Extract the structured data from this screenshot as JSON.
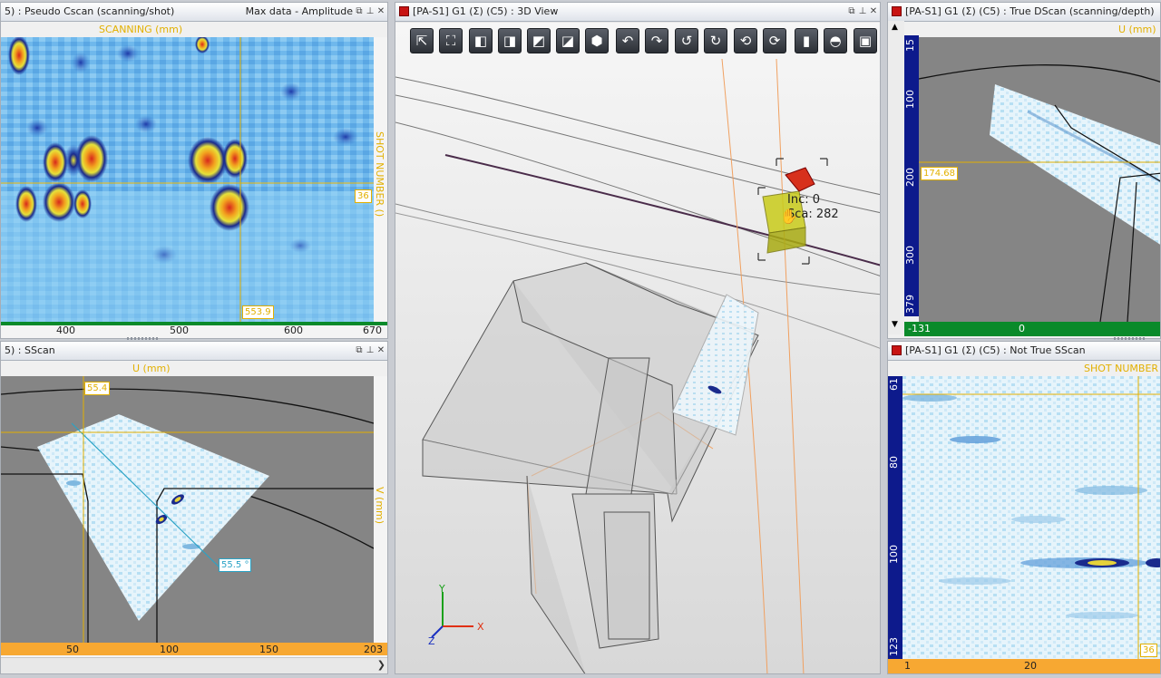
{
  "colors": {
    "accent": "#e2b000",
    "cursor_blue": "#2aa3c6",
    "green_bar": "#0a8a2a",
    "orange_bar": "#f7a832",
    "navy_bar": "#0d1a8c"
  },
  "cscan": {
    "title": "5) : Pseudo Cscan (scanning/shot)",
    "title_right": "Max data - Amplitude",
    "x_axis_label": "SCANNING (mm)",
    "y_axis_label": "SHOT NUMBER ()",
    "cursor_y": "36",
    "cursor_x": "553.9",
    "ticks": [
      "400",
      "500",
      "600",
      "670"
    ]
  },
  "sscan": {
    "title": "5) : SScan",
    "x_axis_label": "U (mm)",
    "y_axis_label": "V (mm)",
    "cursor_u": "55.4",
    "cursor_angle": "55.5 °",
    "ticks": [
      "50",
      "100",
      "150",
      "203"
    ]
  },
  "view3d": {
    "title": "[PA-S1] G1 (Σ) (C5) : 3D View",
    "toolbar": [
      "select-tool",
      "fit-view",
      "view-front",
      "view-back",
      "view-side",
      "view-iso",
      "view-solid",
      "rotate-left",
      "rotate-right",
      "rotate-ccw",
      "rotate-cw",
      "rotate-reset",
      "rotate-refresh",
      "ruler",
      "protractor",
      "box-view"
    ],
    "probe_label_1": "Inc: 0",
    "probe_label_2": "Sca: 282",
    "axis_x": "X",
    "axis_y": "Y",
    "axis_z": "Z"
  },
  "dscan": {
    "title": "[PA-S1] G1 (Σ) (C5) : True DScan (scanning/depth)",
    "x_axis_label": "U (mm)",
    "cursor_depth": "174.68",
    "y_ticks": [
      "15",
      "100",
      "200",
      "300",
      "379"
    ],
    "x_ticks": [
      "-131",
      "0"
    ]
  },
  "ntsscan": {
    "title": "[PA-S1] G1 (Σ) (C5) : Not True SScan",
    "x_axis_label": "SHOT NUMBER",
    "cursor_value": "36",
    "y_ticks": [
      "61",
      "80",
      "100",
      "123"
    ],
    "x_ticks": [
      "1",
      "20"
    ]
  }
}
